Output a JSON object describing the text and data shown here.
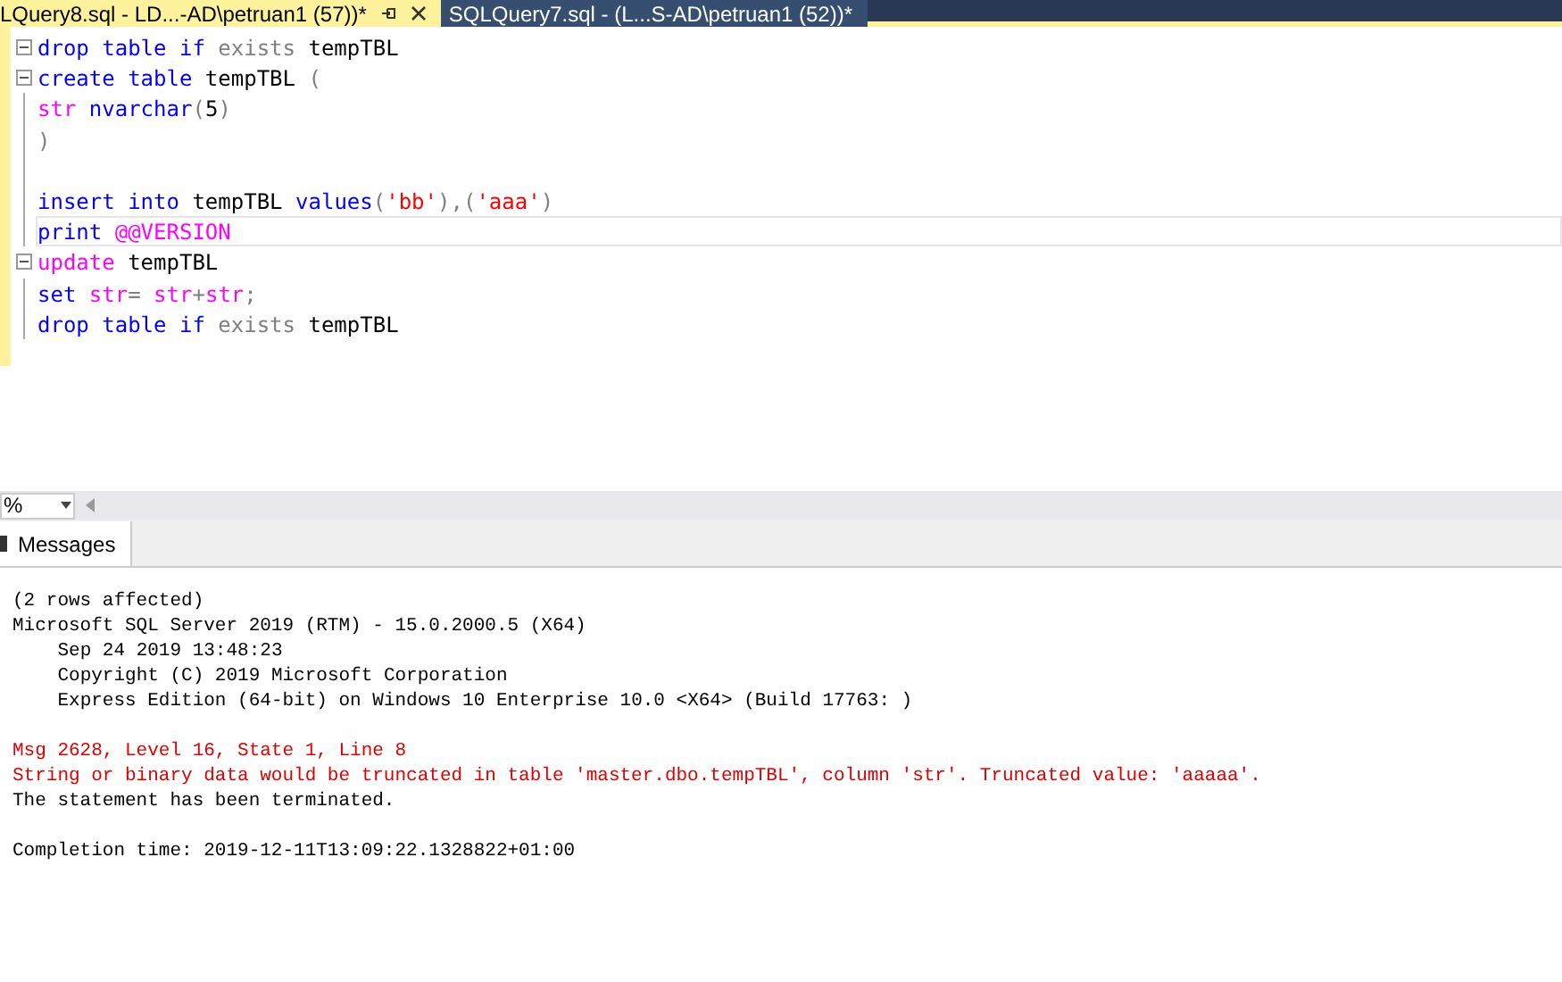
{
  "tabs": [
    {
      "label": "LQuery8.sql - LD...-AD\\petruan1 (57))*",
      "selected": true
    },
    {
      "label": "SQLQuery7.sql - (L...S-AD\\petruan1 (52))*",
      "selected": false
    }
  ],
  "editor": {
    "lines": [
      {
        "fold": true,
        "current": false,
        "tokens": [
          {
            "text": "drop table if",
            "kind": "keyword"
          },
          {
            "text": " exists",
            "kind": "grey"
          },
          {
            "text": " tempTBL",
            "kind": "plain"
          }
        ]
      },
      {
        "fold": true,
        "current": false,
        "tokens": [
          {
            "text": "create table",
            "kind": "keyword"
          },
          {
            "text": " tempTBL ",
            "kind": "plain"
          },
          {
            "text": "(",
            "kind": "grey"
          }
        ]
      },
      {
        "fold": false,
        "current": false,
        "tokens": [
          {
            "text": "str",
            "kind": "magenta"
          },
          {
            "text": " nvarchar",
            "kind": "keyword"
          },
          {
            "text": "(",
            "kind": "grey"
          },
          {
            "text": "5",
            "kind": "plain"
          },
          {
            "text": ")",
            "kind": "grey"
          }
        ]
      },
      {
        "fold": false,
        "current": false,
        "tokens": [
          {
            "text": ")",
            "kind": "grey"
          }
        ]
      },
      {
        "fold": false,
        "current": false
      },
      {
        "fold": false,
        "current": false,
        "tokens": [
          {
            "text": "insert into",
            "kind": "keyword"
          },
          {
            "text": " tempTBL ",
            "kind": "plain"
          },
          {
            "text": "values",
            "kind": "keyword"
          },
          {
            "text": "(",
            "kind": "grey"
          },
          {
            "text": "'bb'",
            "kind": "string"
          },
          {
            "text": "),(",
            "kind": "grey"
          },
          {
            "text": "'aaa'",
            "kind": "string"
          },
          {
            "text": ")",
            "kind": "grey"
          }
        ]
      },
      {
        "fold": false,
        "current": true,
        "tokens": [
          {
            "text": "print",
            "kind": "keyword"
          },
          {
            "text": " @@VERSION",
            "kind": "magenta"
          }
        ]
      },
      {
        "fold": true,
        "current": false,
        "tokens": [
          {
            "text": "update",
            "kind": "magenta"
          },
          {
            "text": " tempTBL",
            "kind": "plain"
          }
        ]
      },
      {
        "fold": false,
        "current": false,
        "tokens": [
          {
            "text": "set",
            "kind": "keyword"
          },
          {
            "text": " str",
            "kind": "magenta"
          },
          {
            "text": "=",
            "kind": "grey"
          },
          {
            "text": " str",
            "kind": "magenta"
          },
          {
            "text": "+",
            "kind": "grey"
          },
          {
            "text": "str",
            "kind": "magenta"
          },
          {
            "text": ";",
            "kind": "grey"
          }
        ]
      },
      {
        "fold": false,
        "current": false,
        "tokens": [
          {
            "text": "drop table if",
            "kind": "keyword"
          },
          {
            "text": " exists",
            "kind": "grey"
          },
          {
            "text": " tempTBL",
            "kind": "plain"
          }
        ]
      }
    ]
  },
  "zoom": {
    "value": "%"
  },
  "results_tabs": [
    {
      "label": "Messages",
      "selected": true
    }
  ],
  "messages": [
    {
      "text": "(2 rows affected)",
      "kind": "normal"
    },
    {
      "text": "Microsoft SQL Server 2019 (RTM) - 15.0.2000.5 (X64)",
      "kind": "normal"
    },
    {
      "text": "\tSep 24 2019 13:48:23",
      "kind": "normal"
    },
    {
      "text": "\tCopyright (C) 2019 Microsoft Corporation",
      "kind": "normal"
    },
    {
      "text": "\tExpress Edition (64-bit) on Windows 10 Enterprise 10.0 <X64> (Build 17763: )",
      "kind": "normal"
    },
    {
      "kind": "blank"
    },
    {
      "text": "Msg 2628, Level 16, State 1, Line 8",
      "kind": "error"
    },
    {
      "text": "String or binary data would be truncated in table 'master.dbo.tempTBL', column 'str'. Truncated value: 'aaaaa'.",
      "kind": "error"
    },
    {
      "text": "The statement has been terminated.",
      "kind": "normal"
    },
    {
      "kind": "blank"
    },
    {
      "text": "Completion time: 2019-12-11T13:09:22.1328822+01:00",
      "kind": "normal"
    }
  ]
}
